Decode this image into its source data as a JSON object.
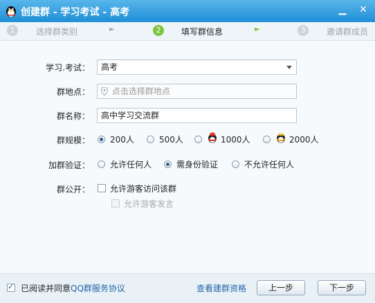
{
  "window": {
    "title": "创建群 - 学习考试 - 高考"
  },
  "steps": [
    {
      "num": "1",
      "label": "选择群类别"
    },
    {
      "num": "2",
      "label": "填写群信息"
    },
    {
      "num": "3",
      "label": "邀请群成员"
    }
  ],
  "form": {
    "category": {
      "label": "学习.考试：",
      "value": "高考"
    },
    "location": {
      "label": "群地点：",
      "placeholder": "点击选择群地点"
    },
    "name": {
      "label": "群名称：",
      "value": "高中学习交流群"
    },
    "size": {
      "label": "群规模：",
      "options": [
        "200人",
        "500人",
        "1000人",
        "2000人"
      ],
      "selected": "200人"
    },
    "verify": {
      "label": "加群验证：",
      "options": [
        "允许任何人",
        "需身份验证",
        "不允许任何人"
      ],
      "selected": "需身份验证"
    },
    "public": {
      "label": "群公开：",
      "guest_access": "允许游客访问该群",
      "guest_speak": "允许游客发言"
    }
  },
  "footer": {
    "agree_text": "已阅读并同意",
    "agreement_link": "QQ群服务协议",
    "view_link": "查看建群资格",
    "prev_button": "上一步",
    "next_button": "下一步"
  },
  "colors": {
    "titlebar": "#1f8fd6",
    "step_active": "#7cc440",
    "step_inactive": "#c9d4dc",
    "link": "#2266aa"
  }
}
